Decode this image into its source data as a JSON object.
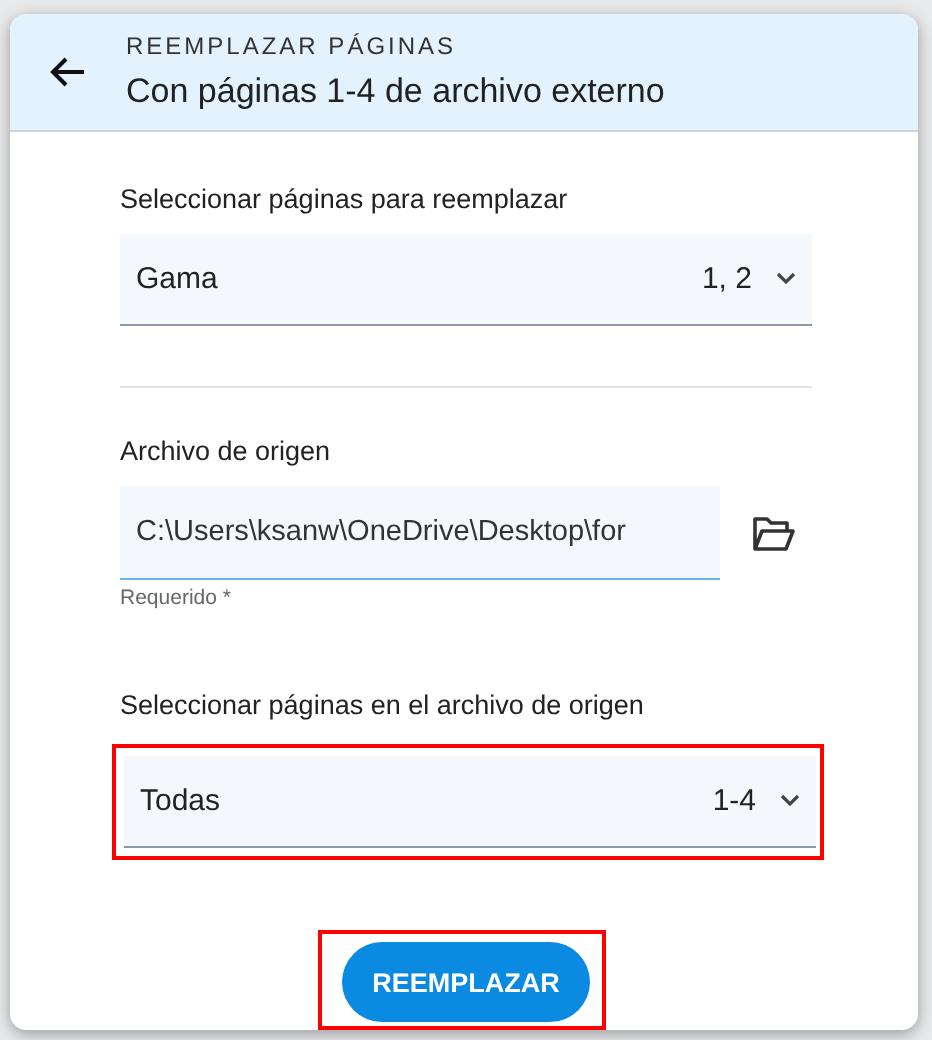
{
  "dialog": {
    "overline": "REEMPLAZAR PÁGINAS",
    "title": "Con páginas 1-4 de archivo externo"
  },
  "target": {
    "label": "Seleccionar páginas para reemplazar",
    "value": "Gama",
    "range": "1, 2",
    "highlighted": false
  },
  "source_file": {
    "label": "Archivo de origen",
    "value": "C:\\Users\\ksanw\\OneDrive\\Desktop\\for",
    "helper": "Requerido *"
  },
  "source_pages": {
    "label": "Seleccionar páginas en el archivo de origen",
    "value": "Todas",
    "range": "1-4",
    "highlighted": true
  },
  "action": {
    "label": "REEMPLAZAR",
    "highlighted": true
  }
}
